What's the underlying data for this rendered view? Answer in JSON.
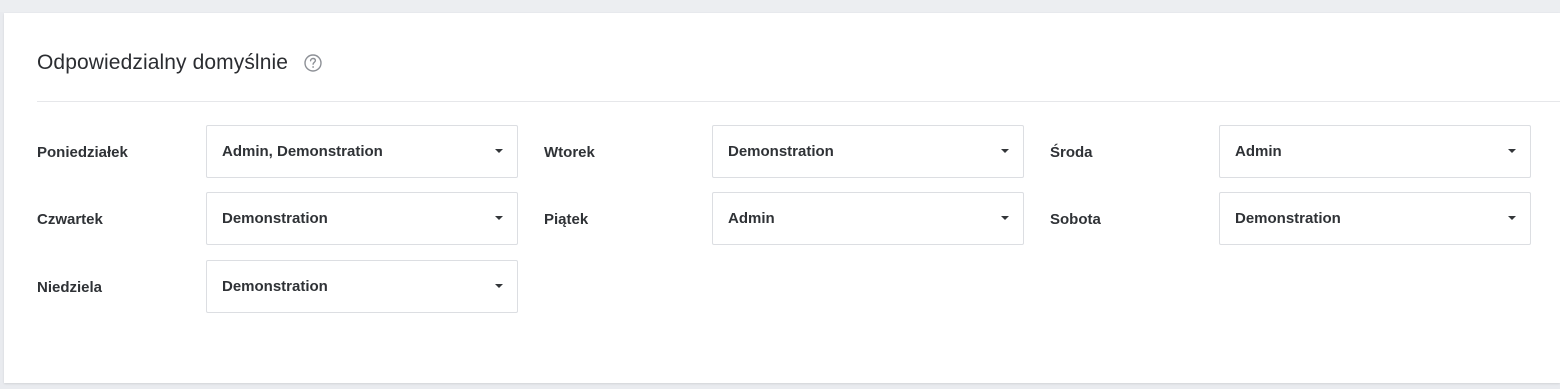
{
  "section": {
    "title": "Odpowiedzialny domyślnie",
    "help_icon": "question-circle-icon"
  },
  "days": [
    {
      "label": "Poniedziałek",
      "value": "Admin, Demonstration"
    },
    {
      "label": "Wtorek",
      "value": "Demonstration"
    },
    {
      "label": "Środa",
      "value": "Admin"
    },
    {
      "label": "Czwartek",
      "value": "Demonstration"
    },
    {
      "label": "Piątek",
      "value": "Admin"
    },
    {
      "label": "Sobota",
      "value": "Demonstration"
    },
    {
      "label": "Niedziela",
      "value": "Demonstration"
    }
  ],
  "colors": {
    "background": "#e9ebef",
    "panel": "#ffffff",
    "border": "#dcdee2",
    "text": "#2f3236"
  }
}
